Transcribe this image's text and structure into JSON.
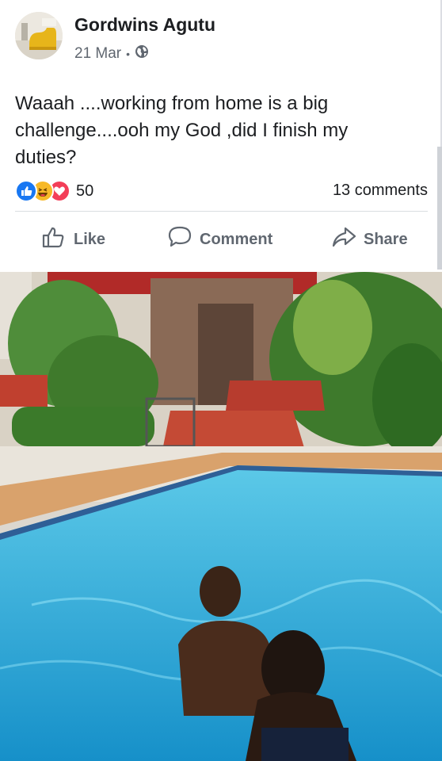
{
  "post": {
    "author": "Gordwins Agutu",
    "date": "21 Mar",
    "audience_icon": "globe-icon",
    "text": "Waaah ....working from home is a big challenge....ooh my God ,did I finish my duties?"
  },
  "reactions": {
    "icons": [
      "like-icon",
      "haha-icon",
      "love-icon"
    ],
    "count": "50",
    "comments": "13 comments"
  },
  "actions": {
    "like": "Like",
    "comment": "Comment",
    "share": "Share"
  },
  "colors": {
    "like_blue": "#1877f2",
    "haha_yellow": "#f7b928",
    "love_red": "#f33e58",
    "action_gray": "#606770",
    "pool_blue": "#2aa8d6"
  }
}
